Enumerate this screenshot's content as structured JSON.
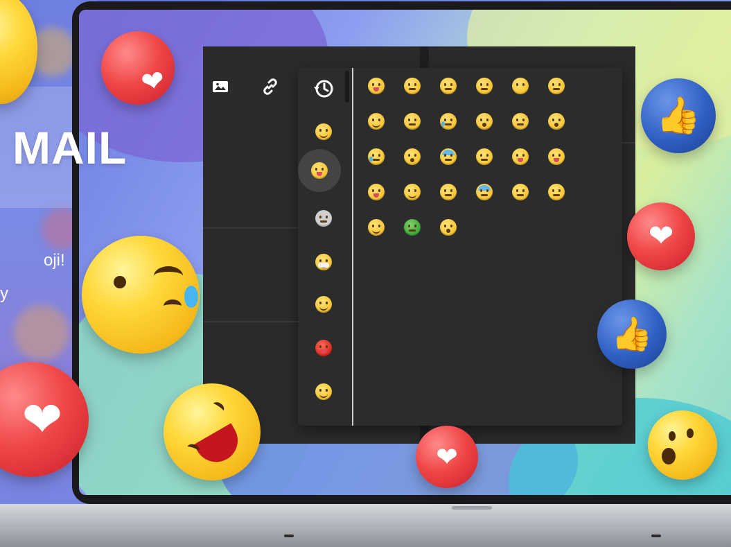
{
  "promo": {
    "title": "MAIL",
    "subtitle": "oji!",
    "subtitle2": "y"
  },
  "toolbar": {
    "icons": [
      "image-icon",
      "link-icon"
    ]
  },
  "picker": {
    "categories": [
      {
        "name": "recent-icon"
      },
      {
        "name": "smileys-category-icon"
      },
      {
        "name": "thinking-category-icon",
        "active": true
      },
      {
        "name": "sad-category-icon"
      },
      {
        "name": "mask-category-icon"
      },
      {
        "name": "halo-category-icon"
      },
      {
        "name": "devil-category-icon"
      },
      {
        "name": "cat-category-icon"
      }
    ],
    "emojis": [
      {
        "name": "thinking-emoji",
        "style": "tongue"
      },
      {
        "name": "slightly-frowning-emoji",
        "style": "flat"
      },
      {
        "name": "neutral-emoji",
        "style": "flat"
      },
      {
        "name": "expressionless-emoji",
        "style": "flat"
      },
      {
        "name": "no-mouth-emoji",
        "style": "none"
      },
      {
        "name": "rolling-eyes-emoji",
        "style": "flat"
      },
      {
        "name": "smirk-emoji",
        "style": "smile"
      },
      {
        "name": "persevere-emoji",
        "style": "flat"
      },
      {
        "name": "sad-relieved-emoji",
        "style": "tear"
      },
      {
        "name": "hushed-emoji",
        "style": "o"
      },
      {
        "name": "zipper-mouth-emoji",
        "style": "flat"
      },
      {
        "name": "astonished-emoji",
        "style": "o"
      },
      {
        "name": "loudly-crying-emoji",
        "style": "tear"
      },
      {
        "name": "tired-emoji",
        "style": "o"
      },
      {
        "name": "cold-sweat-emoji",
        "style": "blue"
      },
      {
        "name": "sleepy-emoji",
        "style": "flat"
      },
      {
        "name": "tongue-out-emoji",
        "style": "tongue"
      },
      {
        "name": "winking-tongue-emoji",
        "style": "tongue"
      },
      {
        "name": "squinting-tongue-emoji",
        "style": "tongue"
      },
      {
        "name": "yum-emoji",
        "style": "smile"
      },
      {
        "name": "unamused-emoji",
        "style": "flat"
      },
      {
        "name": "sweat-emoji",
        "style": "blue"
      },
      {
        "name": "pensive-emoji",
        "style": "flat"
      },
      {
        "name": "confused-emoji",
        "style": "flat"
      },
      {
        "name": "upside-down-emoji",
        "style": "smile"
      },
      {
        "name": "nauseated-emoji",
        "style": "green"
      },
      {
        "name": "scream-emoji",
        "style": "o"
      }
    ]
  },
  "colors": {
    "window_bg": "#2b2b2b",
    "picker_bg": "#2c2c2c",
    "accent_yellow": "#f8c83a",
    "heart_red": "#f04848",
    "like_blue": "#2f5fc4"
  }
}
